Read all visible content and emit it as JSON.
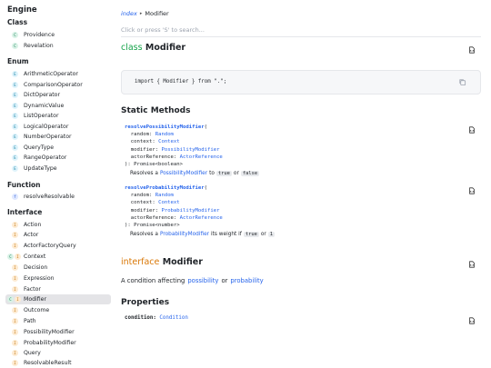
{
  "sidebar": {
    "title": "Engine",
    "sections": [
      {
        "heading": "Class",
        "items": [
          {
            "label": "Providence",
            "badge": "C",
            "kind": "cls"
          },
          {
            "label": "Revelation",
            "badge": "C",
            "kind": "cls"
          }
        ]
      },
      {
        "heading": "Enum",
        "items": [
          {
            "label": "ArithmeticOperator",
            "badge": "E",
            "kind": "enm"
          },
          {
            "label": "ComparisonOperator",
            "badge": "E",
            "kind": "enm"
          },
          {
            "label": "DictOperator",
            "badge": "E",
            "kind": "enm"
          },
          {
            "label": "DynamicValue",
            "badge": "E",
            "kind": "enm"
          },
          {
            "label": "ListOperator",
            "badge": "E",
            "kind": "enm"
          },
          {
            "label": "LogicalOperator",
            "badge": "E",
            "kind": "enm"
          },
          {
            "label": "NumberOperator",
            "badge": "E",
            "kind": "enm"
          },
          {
            "label": "QueryType",
            "badge": "E",
            "kind": "enm"
          },
          {
            "label": "RangeOperator",
            "badge": "E",
            "kind": "enm"
          },
          {
            "label": "UpdateType",
            "badge": "E",
            "kind": "enm"
          }
        ]
      },
      {
        "heading": "Function",
        "items": [
          {
            "label": "resolveResolvable",
            "badge": "f",
            "kind": "fn"
          }
        ]
      },
      {
        "heading": "Interface",
        "items": [
          {
            "label": "Action",
            "badge": "I",
            "kind": "itf"
          },
          {
            "label": "Actor",
            "badge": "I",
            "kind": "itf"
          },
          {
            "label": "ActorFactoryQuery",
            "badge": "I",
            "kind": "itf"
          },
          {
            "label": "Context",
            "badge": "C",
            "badge2": "I",
            "kind": "pair"
          },
          {
            "label": "Decision",
            "badge": "I",
            "kind": "itf"
          },
          {
            "label": "Expression",
            "badge": "I",
            "kind": "itf"
          },
          {
            "label": "Factor",
            "badge": "I",
            "kind": "itf"
          },
          {
            "label": "Modifier",
            "badge": "C",
            "badge2": "I",
            "kind": "pair",
            "active": true
          },
          {
            "label": "Outcome",
            "badge": "I",
            "kind": "itf"
          },
          {
            "label": "Path",
            "badge": "I",
            "kind": "itf"
          },
          {
            "label": "PossibilityModifier",
            "badge": "I",
            "kind": "itf"
          },
          {
            "label": "ProbabilityModifier",
            "badge": "I",
            "kind": "itf"
          },
          {
            "label": "Query",
            "badge": "I",
            "kind": "itf"
          },
          {
            "label": "ResolvableResult",
            "badge": "I",
            "kind": "itf"
          }
        ]
      }
    ]
  },
  "breadcrumb": {
    "link": "index",
    "arrow": "▸",
    "current": "Modifier"
  },
  "search": {
    "placeholder": "Click or press 'S' to search..."
  },
  "class_section": {
    "keyword": "class",
    "name": "Modifier"
  },
  "import_code": "import { Modifier } from \".\";",
  "static_methods": {
    "heading": "Static Methods",
    "methods": [
      {
        "name": "resolvePossibilityModifier",
        "open": "(",
        "params": [
          {
            "name": "random",
            "type": "Random"
          },
          {
            "name": "context",
            "type": "Context"
          },
          {
            "name": "modifier",
            "type": "PossibilityModifier"
          },
          {
            "name": "actorReference",
            "type": "ActorReference"
          }
        ],
        "returns": "): Promise<boolean>",
        "desc": {
          "pre": "Resolves a",
          "type": "PossibilityModifier",
          "mid": "to",
          "chip1": "true",
          "or": "or",
          "chip2": "false"
        }
      },
      {
        "name": "resolveProbabilityModifier",
        "open": "(",
        "params": [
          {
            "name": "random",
            "type": "Random"
          },
          {
            "name": "context",
            "type": "Context"
          },
          {
            "name": "modifier",
            "type": "ProbabilityModifier"
          },
          {
            "name": "actorReference",
            "type": "ActorReference"
          }
        ],
        "returns": "): Promise<number>",
        "desc": {
          "pre": "Resolves a",
          "type": "ProbabilityModifier",
          "mid": "its weight if",
          "chip1": "true",
          "or": "or",
          "chip2": "1"
        }
      }
    ]
  },
  "interface_section": {
    "keyword": "interface",
    "name": "Modifier",
    "desc_pre": "A condition affecting",
    "link1": "possibility",
    "or": "or",
    "link2": "probability"
  },
  "properties": {
    "heading": "Properties",
    "items": [
      {
        "name": "condition",
        "colon": ":",
        "type": "Condition"
      }
    ]
  },
  "colors": {
    "link": "#2563eb",
    "class_kw": "#16a34a",
    "interface_kw": "#d97706"
  }
}
